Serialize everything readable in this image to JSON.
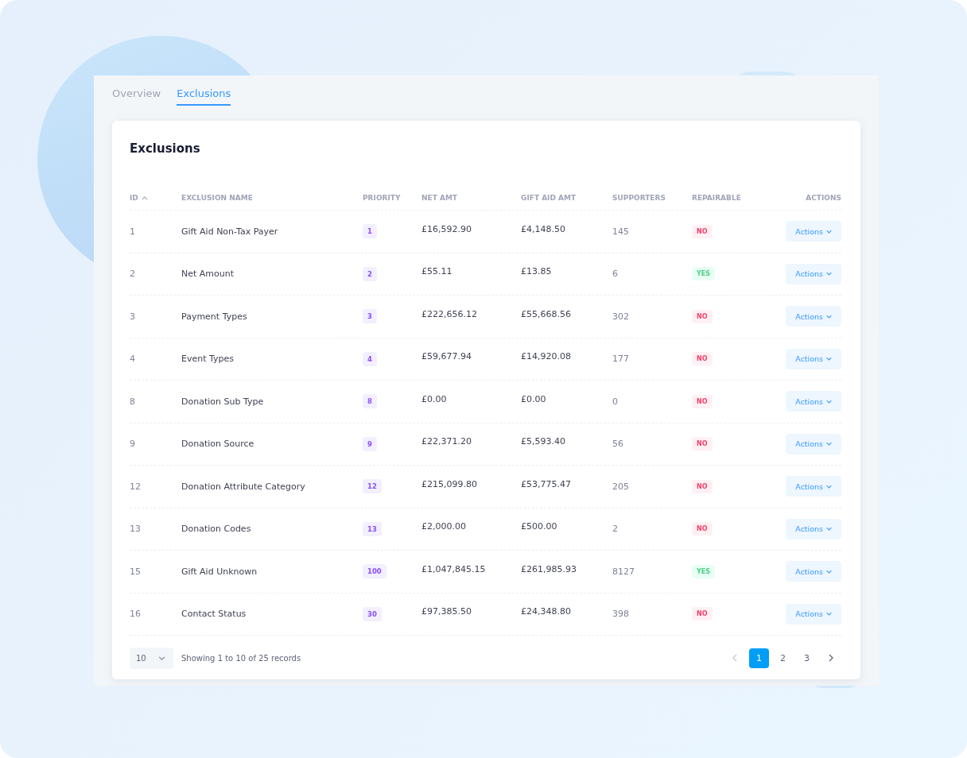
{
  "tabs": [
    {
      "label": "Overview",
      "selected": false
    },
    {
      "label": "Exclusions",
      "selected": true
    }
  ],
  "card": {
    "title": "Exclusions"
  },
  "table": {
    "columns": [
      {
        "label": "ID",
        "sorted": true
      },
      {
        "label": "EXCLUSION NAME",
        "sorted": false
      },
      {
        "label": "PRIORITY",
        "sorted": false
      },
      {
        "label": "NET AMT",
        "sorted": false
      },
      {
        "label": "GIFT AID AMT",
        "sorted": false
      },
      {
        "label": "SUPPORTERS",
        "sorted": false
      },
      {
        "label": "REPAIRABLE",
        "sorted": false
      },
      {
        "label": "ACTIONS",
        "sorted": false
      }
    ],
    "rows": [
      {
        "id": "1",
        "name": "Gift Aid Non-Tax Payer",
        "priority": "1",
        "net": "£16,592.90",
        "gift_aid": "£4,148.50",
        "supporters": "145",
        "repairable": false,
        "repairable_text": "NO",
        "action": "Actions"
      },
      {
        "id": "2",
        "name": "Net Amount",
        "priority": "2",
        "net": "£55.11",
        "gift_aid": "£13.85",
        "supporters": "6",
        "repairable": true,
        "repairable_text": "YES",
        "action": "Actions"
      },
      {
        "id": "3",
        "name": "Payment Types",
        "priority": "3",
        "net": "£222,656.12",
        "gift_aid": "£55,668.56",
        "supporters": "302",
        "repairable": false,
        "repairable_text": "NO",
        "action": "Actions"
      },
      {
        "id": "4",
        "name": "Event Types",
        "priority": "4",
        "net": "£59,677.94",
        "gift_aid": "£14,920.08",
        "supporters": "177",
        "repairable": false,
        "repairable_text": "NO",
        "action": "Actions"
      },
      {
        "id": "8",
        "name": "Donation Sub Type",
        "priority": "8",
        "net": "£0.00",
        "gift_aid": "£0.00",
        "supporters": "0",
        "repairable": false,
        "repairable_text": "NO",
        "action": "Actions"
      },
      {
        "id": "9",
        "name": "Donation Source",
        "priority": "9",
        "net": "£22,371.20",
        "gift_aid": "£5,593.40",
        "supporters": "56",
        "repairable": false,
        "repairable_text": "NO",
        "action": "Actions"
      },
      {
        "id": "12",
        "name": "Donation Attribute Category",
        "priority": "12",
        "net": "£215,099.80",
        "gift_aid": "£53,775.47",
        "supporters": "205",
        "repairable": false,
        "repairable_text": "NO",
        "action": "Actions"
      },
      {
        "id": "13",
        "name": "Donation Codes",
        "priority": "13",
        "net": "£2,000.00",
        "gift_aid": "£500.00",
        "supporters": "2",
        "repairable": false,
        "repairable_text": "NO",
        "action": "Actions"
      },
      {
        "id": "15",
        "name": "Gift Aid Unknown",
        "priority": "100",
        "net": "£1,047,845.15",
        "gift_aid": "£261,985.93",
        "supporters": "8127",
        "repairable": true,
        "repairable_text": "YES",
        "action": "Actions"
      },
      {
        "id": "16",
        "name": "Contact Status",
        "priority": "30",
        "net": "£97,385.50",
        "gift_aid": "£24,348.80",
        "supporters": "398",
        "repairable": false,
        "repairable_text": "NO",
        "action": "Actions"
      }
    ]
  },
  "footer": {
    "page_size": "10",
    "summary": "Showing 1 to 10 of 25 records",
    "pages": [
      {
        "label": "1",
        "selected": true
      },
      {
        "label": "2",
        "selected": false
      },
      {
        "label": "3",
        "selected": false
      }
    ]
  }
}
